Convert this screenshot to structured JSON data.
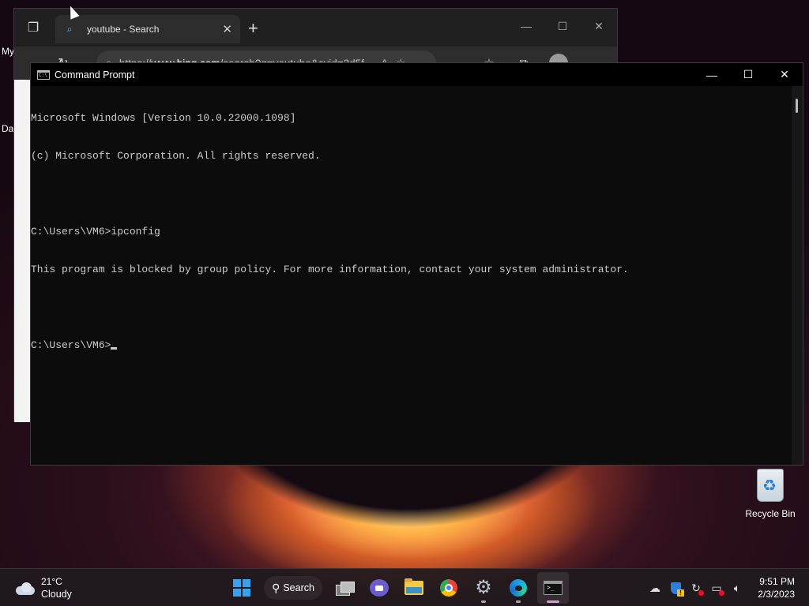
{
  "desktop": {
    "partial_labels": [
      "My",
      "Da"
    ],
    "recycle_bin": {
      "label": "Recycle Bin",
      "icon": "recycle-bin-icon"
    }
  },
  "browser": {
    "tab": {
      "title": "youtube - Search",
      "favicon": "bing-search-icon"
    },
    "url": {
      "prefix": "https://",
      "host": "www.bing.com",
      "path": "/search?q=youtube&cvid=3d5f..."
    },
    "controls": {
      "minimize": "—",
      "maximize": "☐",
      "close": "✕"
    }
  },
  "cmd": {
    "title": "Command Prompt",
    "controls": {
      "minimize": "—",
      "maximize": "☐",
      "close": "✕"
    },
    "lines": [
      "Microsoft Windows [Version 10.0.22000.1098]",
      "(c) Microsoft Corporation. All rights reserved.",
      "",
      "C:\\Users\\VM6>ipconfig",
      "This program is blocked by group policy. For more information, contact your system administrator.",
      ""
    ],
    "prompt": "C:\\Users\\VM6>"
  },
  "taskbar": {
    "weather": {
      "temp": "21°C",
      "condition": "Cloudy",
      "icon": "cloud-icon"
    },
    "search_label": "Search",
    "apps": [
      {
        "name": "start",
        "icon": "windows-logo-icon"
      },
      {
        "name": "search",
        "icon": "search-icon"
      },
      {
        "name": "task-view",
        "icon": "task-view-icon"
      },
      {
        "name": "chat",
        "icon": "teams-chat-icon"
      },
      {
        "name": "file-explorer",
        "icon": "folder-icon"
      },
      {
        "name": "chrome",
        "icon": "chrome-icon"
      },
      {
        "name": "settings",
        "icon": "gear-icon"
      },
      {
        "name": "edge",
        "icon": "edge-icon"
      },
      {
        "name": "command-prompt",
        "icon": "terminal-icon",
        "active": true
      }
    ],
    "clock": {
      "time": "9:51 PM",
      "date": "2/3/2023"
    }
  }
}
